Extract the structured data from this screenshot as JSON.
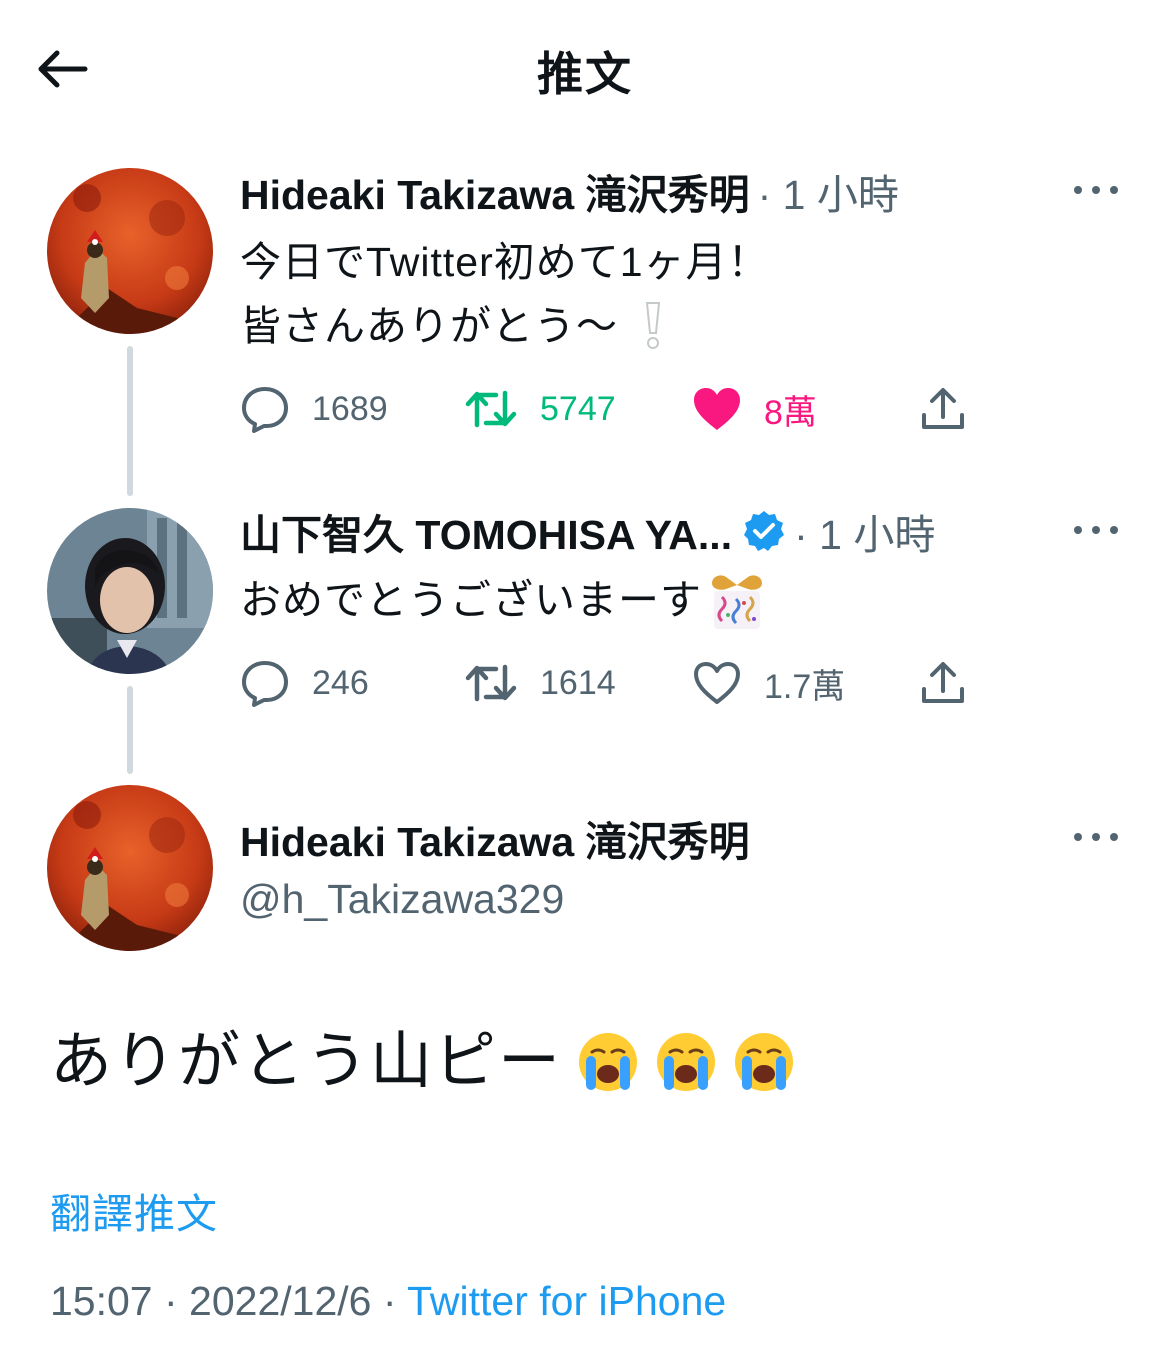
{
  "header": {
    "title": "推文",
    "back_icon": "arrow-left-icon"
  },
  "colors": {
    "accent": "#1d9bf0",
    "retweet": "#00ba7c",
    "like": "#f91880",
    "muted": "#536471",
    "text": "#0f1419"
  },
  "thread": [
    {
      "name": "Hideaki Takizawa 滝沢秀明",
      "time": "· 1 小時",
      "text_lines": [
        "今日でTwitter初めて1ヶ月！",
        "皆さんありがとう～"
      ],
      "emoji": "white-exclamation",
      "reply_count": "1689",
      "retweet_count": "5747",
      "like_count": "8萬",
      "retweeted": true,
      "liked": true
    },
    {
      "name": "山下智久 TOMOHISA YA...",
      "verified": true,
      "time": "· 1 小時",
      "text": "おめでとうございまーす",
      "emoji": "party-popper",
      "reply_count": "246",
      "retweet_count": "1614",
      "like_count": "1.7萬",
      "retweeted": false,
      "liked": false
    }
  ],
  "main_tweet": {
    "name": "Hideaki Takizawa 滝沢秀明",
    "handle": "@h_Takizawa329",
    "text": "ありがとう山ピー",
    "emojis": [
      "loudly-crying-face",
      "loudly-crying-face",
      "loudly-crying-face"
    ],
    "translate_label": "翻譯推文",
    "timestamp": "15:07 · 2022/12/6 · ",
    "source": "Twitter for iPhone"
  }
}
